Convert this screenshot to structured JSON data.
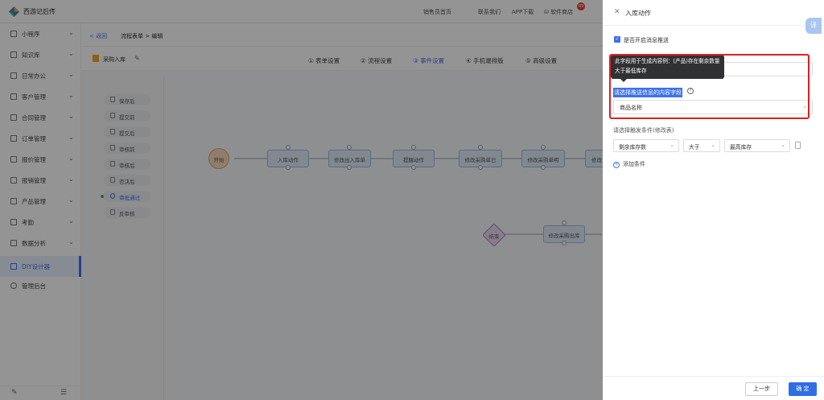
{
  "app": {
    "title": "西游记后传"
  },
  "topnav": {
    "items": [
      "销售员首页",
      "联系我们",
      "APP下载",
      "软件商店"
    ],
    "badge": "99"
  },
  "sidebar": {
    "items": [
      {
        "label": "小程序"
      },
      {
        "label": "知识库"
      },
      {
        "label": "日常办公"
      },
      {
        "label": "客户管理"
      },
      {
        "label": "合同管理"
      },
      {
        "label": "订单管理"
      },
      {
        "label": "报价管理"
      },
      {
        "label": "报销管理"
      },
      {
        "label": "产品管理"
      },
      {
        "label": "考勤"
      },
      {
        "label": "数据分析"
      },
      {
        "label": "DIY设计器"
      },
      {
        "label": "管理后台"
      }
    ]
  },
  "crumbs": {
    "back": "< 返回",
    "path": "流程表单 > 编辑"
  },
  "form": {
    "title": "采购入库"
  },
  "steps": [
    "① 表单设置",
    "② 流程设置",
    "③ 事件设置",
    "④ 手机端排版",
    "⑤ 高级设置"
  ],
  "events": [
    "保存后",
    "提交前",
    "提交后",
    "审核前",
    "审核后",
    "否决后",
    "审批通过",
    "反审核"
  ],
  "flow_nodes": [
    "开始",
    "入库动作",
    "修改出入库单",
    "提醒动作",
    "修改采购单已",
    "修改采购单明",
    "修改",
    "结束",
    "修改采购出库"
  ],
  "drawer": {
    "title": "入库动作",
    "translate": "译",
    "checkbox_label": "是否开启消息推送",
    "tooltip": "此字段用于生成内容例：(产品)存在剩余数量大于最低库存",
    "content_field_label": "请选择推送信息的内容字段",
    "content_field_value": "商品名称",
    "condition_label": "请选择触发条件(修改表)",
    "condition": {
      "field": "剩余库存数",
      "op": "大于",
      "target": "最高库存"
    },
    "add_condition": "添加条件",
    "prev_btn": "上一步",
    "ok_btn": "确 定"
  }
}
